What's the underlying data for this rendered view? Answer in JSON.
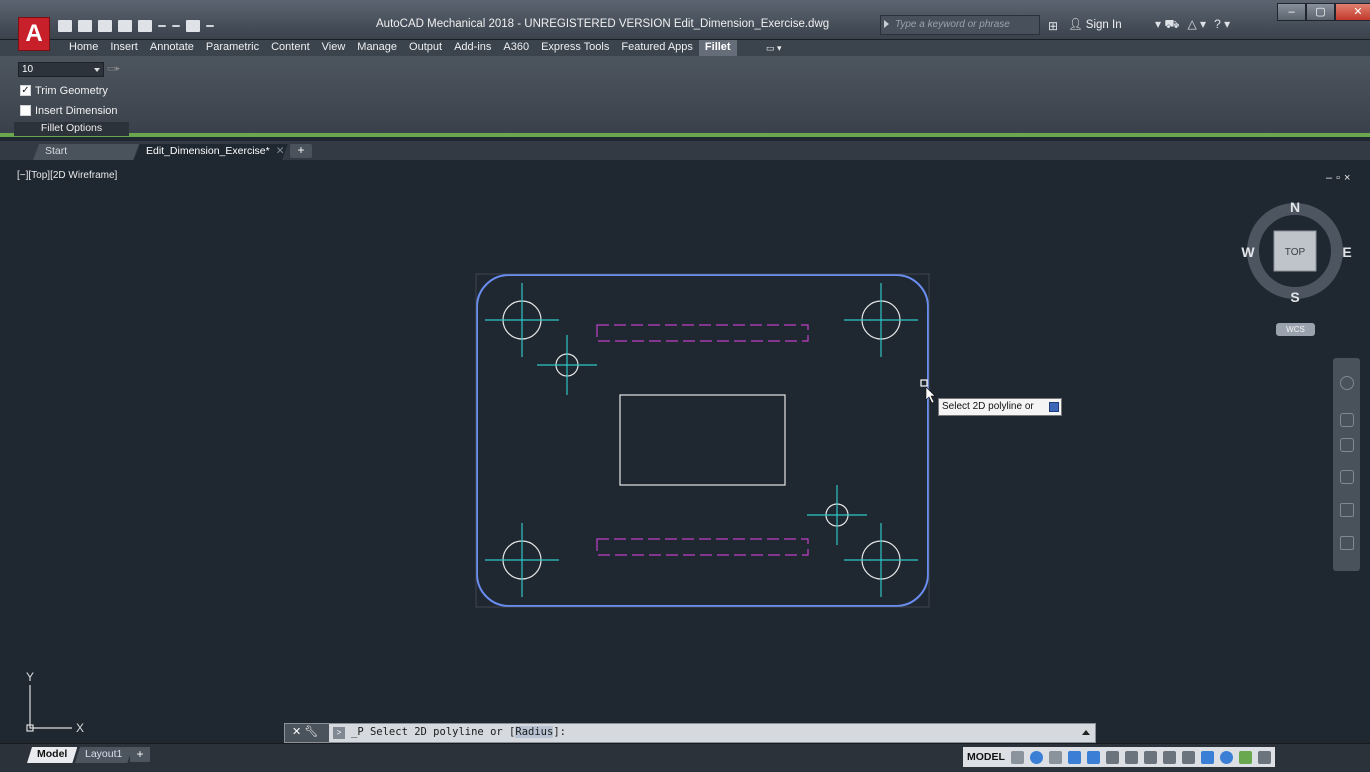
{
  "app": {
    "logo_letter": "A",
    "title": "AutoCAD Mechanical 2018 - UNREGISTERED VERSION    Edit_Dimension_Exercise.dwg",
    "search_placeholder": "Type a keyword or phrase",
    "sign_in": "Sign In"
  },
  "ribbon": {
    "tabs": [
      "Home",
      "Insert",
      "Annotate",
      "Parametric",
      "Content",
      "View",
      "Manage",
      "Output",
      "Add-ins",
      "A360",
      "Express Tools",
      "Featured Apps",
      "Fillet"
    ],
    "active_tab": "Fillet",
    "fillet_panel": {
      "radius_value": "10",
      "trim_geometry_label": "Trim Geometry",
      "trim_geometry_checked": true,
      "insert_dimension_label": "Insert Dimension",
      "insert_dimension_checked": false,
      "panel_title": "Fillet Options"
    }
  },
  "doc_tabs": {
    "start": "Start",
    "active": "Edit_Dimension_Exercise*",
    "plus": "+"
  },
  "viewport": {
    "label": "[−][Top][2D Wireframe]",
    "controls": "– ̅□ ×",
    "tooltip": "Select 2D polyline or",
    "ucs_x": "X",
    "ucs_y": "Y"
  },
  "viewcube": {
    "north": "N",
    "south": "S",
    "east": "E",
    "west": "W",
    "face": "TOP",
    "wcs": "WCS"
  },
  "command_line": {
    "prefix": "_P Select 2D polyline or [",
    "option": "Radius",
    "suffix": "]:"
  },
  "status_bar": {
    "model_tab": "Model",
    "layout_tab": "Layout1",
    "plus": "+",
    "model_button": "MODEL"
  },
  "colors": {
    "polyline": "#6a8df0",
    "centerline": "#2fc7c7",
    "hidden": "#c040c8",
    "geometry": "#e6e6e6",
    "ribbon_accent": "#6aa84f"
  }
}
